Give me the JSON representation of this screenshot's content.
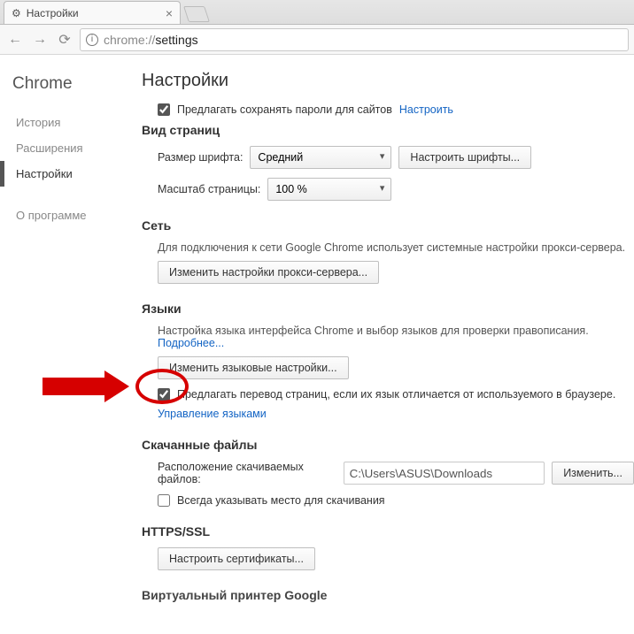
{
  "tab": {
    "title": "Настройки"
  },
  "omnibox": {
    "host": "chrome://",
    "path": "settings"
  },
  "sidebar": {
    "title": "Chrome",
    "items": [
      {
        "label": "История",
        "active": false
      },
      {
        "label": "Расширения",
        "active": false
      },
      {
        "label": "Настройки",
        "active": true
      }
    ],
    "about": "О программе"
  },
  "main": {
    "title": "Настройки",
    "passwords": {
      "checked": true,
      "label": "Предлагать сохранять пароли для сайтов",
      "link": "Настроить"
    },
    "appearance": {
      "title": "Вид страниц",
      "font_label": "Размер шрифта:",
      "font_value": "Средний",
      "font_button": "Настроить шрифты...",
      "zoom_label": "Масштаб страницы:",
      "zoom_value": "100 %"
    },
    "network": {
      "title": "Сеть",
      "desc": "Для подключения к сети Google Chrome использует системные настройки прокси-сервера.",
      "button": "Изменить настройки прокси-сервера..."
    },
    "languages": {
      "title": "Языки",
      "desc_pre": "Настройка языка интерфейса Chrome и выбор языков для проверки правописания.",
      "desc_link": "Подробнее...",
      "button": "Изменить языковые настройки...",
      "translate_checked": true,
      "translate_label": "Предлагать перевод страниц, если их язык отличается от используемого в браузере.",
      "manage_link": "Управление языками"
    },
    "downloads": {
      "title": "Скачанные файлы",
      "path_label": "Расположение скачиваемых файлов:",
      "path_value": "C:\\Users\\ASUS\\Downloads",
      "change_button": "Изменить...",
      "ask_checked": false,
      "ask_label": "Всегда указывать место для скачивания"
    },
    "https": {
      "title": "HTTPS/SSL",
      "button": "Настроить сертификаты..."
    },
    "cutoff": "Виртуальный принтер Google"
  }
}
